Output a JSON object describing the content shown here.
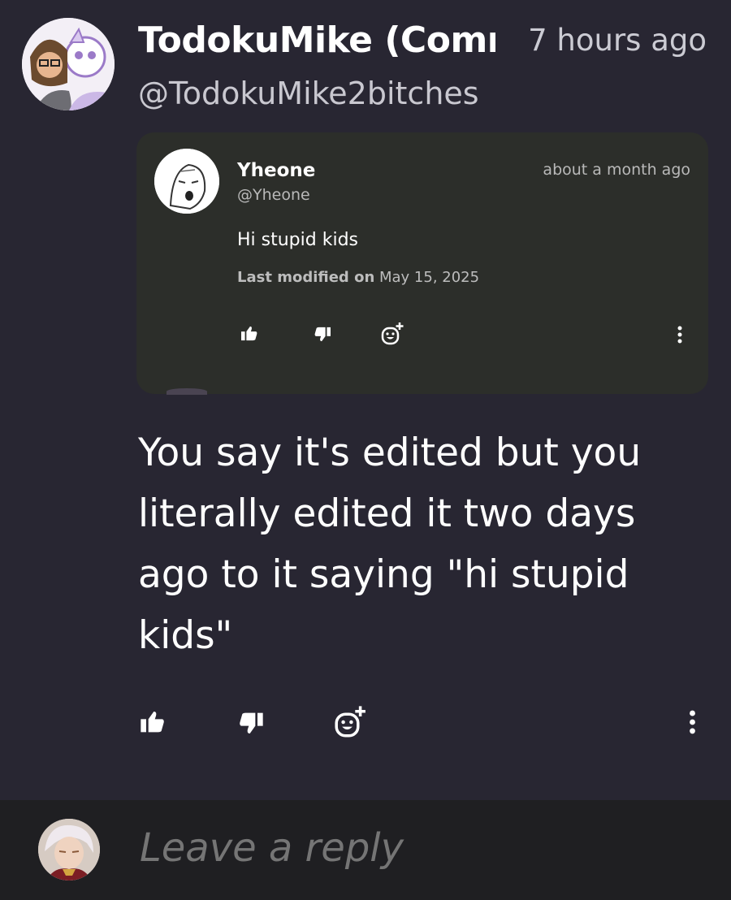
{
  "comment": {
    "username": "TodokuMike (Community Mike)",
    "timestamp": "7 hours ago",
    "handle": "@TodokuMike2bitches",
    "text": "You say it's edited but you literally edited it two days ago to it saying \"hi stupid kids\""
  },
  "quoted": {
    "name": "Yheone",
    "handle": "@Yheone",
    "time": "about a month ago",
    "body": "Hi stupid kids",
    "modified_label": "Last modified on",
    "modified_date": "May 15, 2025"
  },
  "actions": {
    "like_icon": "thumbs-up-icon",
    "dislike_icon": "thumbs-down-icon",
    "react_icon": "add-reaction-icon",
    "more_icon": "more-vertical-icon"
  },
  "reply": {
    "placeholder": "Leave a reply"
  },
  "colors": {
    "background": "#282632",
    "card": "#2c2e2a",
    "reply_bar": "#1f1f22"
  }
}
